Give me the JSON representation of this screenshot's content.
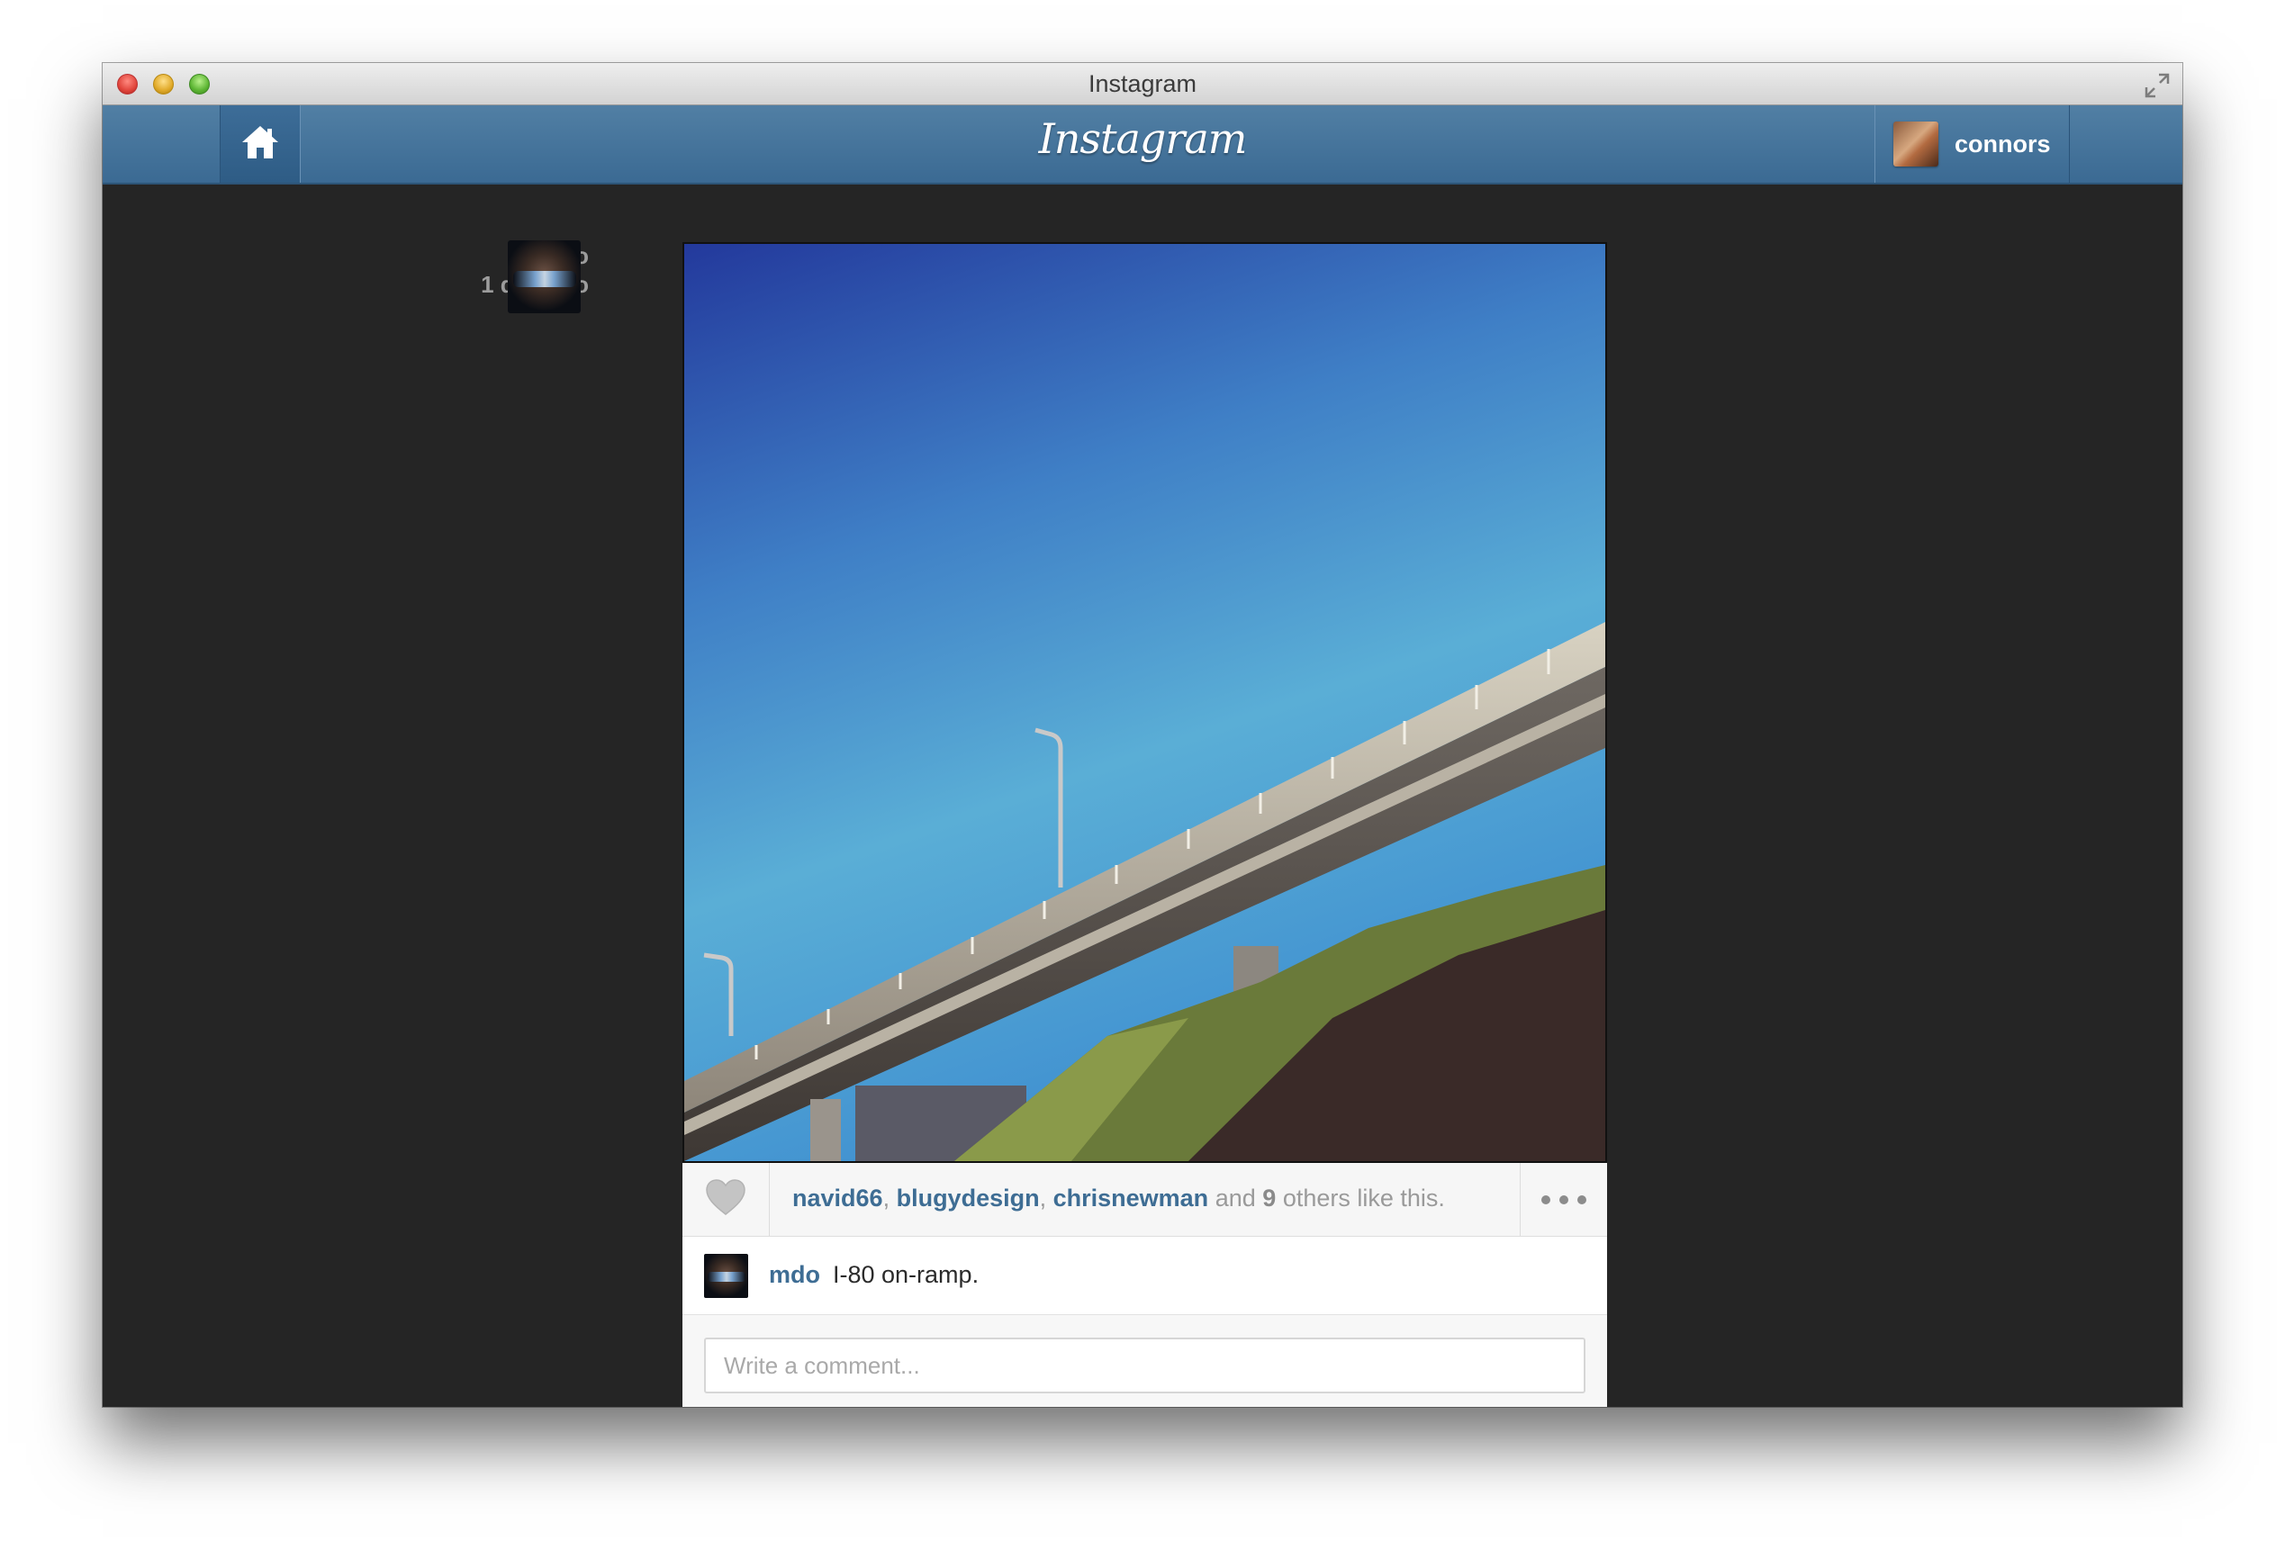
{
  "window": {
    "title": "Instagram"
  },
  "header": {
    "brand": "Instagram",
    "user": {
      "name": "connors"
    }
  },
  "post": {
    "author": "mdo",
    "time_ago": "1 day ago",
    "likes": {
      "users": [
        "navid66",
        "blugydesign",
        "chrisnewman"
      ],
      "and_label": "and",
      "others_count": "9",
      "others_label": "others like this."
    },
    "caption": {
      "user": "mdo",
      "text": "I-80 on-ramp."
    },
    "comment": {
      "placeholder": "Write a comment..."
    }
  },
  "colors": {
    "header_blue": "#3f6e98",
    "link_blue": "#3e6d94",
    "window_bg": "#252525"
  },
  "icons": {
    "home": "home-icon",
    "like": "heart-icon",
    "more": "more-dots-icon",
    "fullscreen": "fullscreen-icon"
  }
}
